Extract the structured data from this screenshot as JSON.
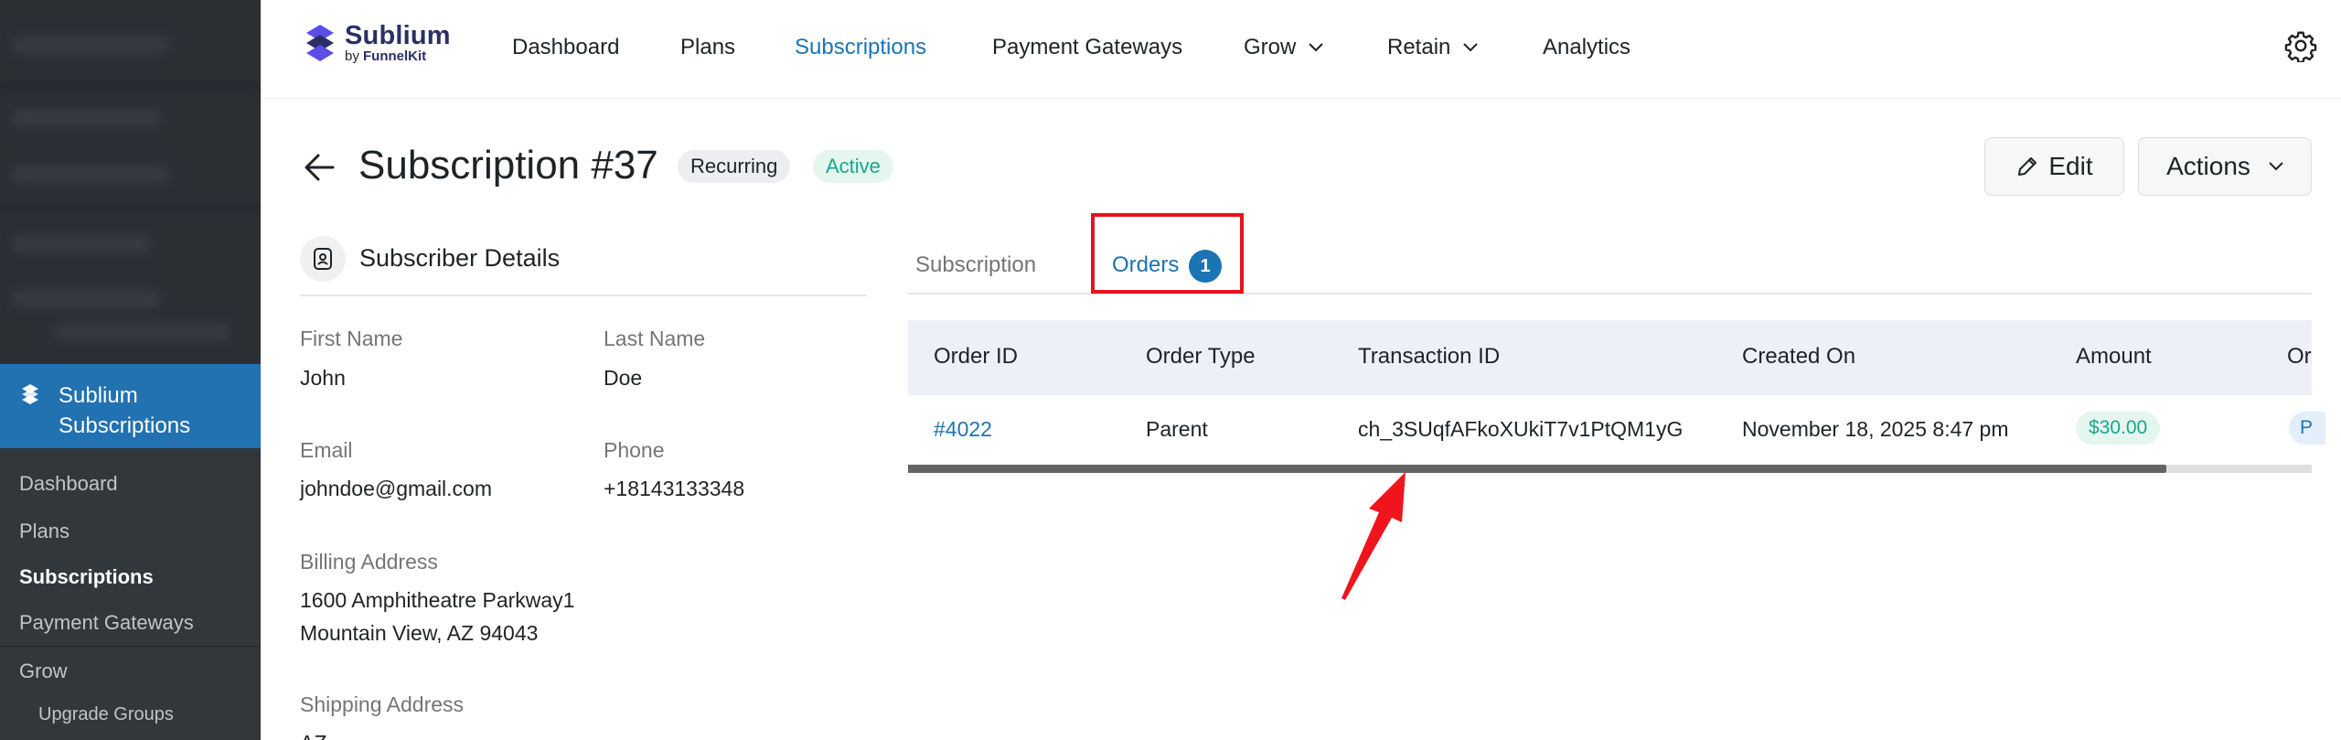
{
  "sidebar": {
    "active_menu": {
      "label_line1": "Sublium",
      "label_line2": "Subscriptions"
    },
    "sub_items": [
      {
        "label": "Dashboard"
      },
      {
        "label": "Plans"
      },
      {
        "label": "Subscriptions"
      },
      {
        "label": "Payment Gateways"
      },
      {
        "label": "Grow"
      },
      {
        "label": "Upgrade Groups"
      }
    ]
  },
  "brand": {
    "name": "Sublium",
    "by_prefix": "by ",
    "by_name": "FunnelKit"
  },
  "topnav": {
    "items": [
      {
        "label": "Dashboard"
      },
      {
        "label": "Plans"
      },
      {
        "label": "Subscriptions"
      },
      {
        "label": "Payment Gateways"
      },
      {
        "label": "Grow"
      },
      {
        "label": "Retain"
      },
      {
        "label": "Analytics"
      }
    ],
    "active": "Subscriptions"
  },
  "header": {
    "title": "Subscription #37",
    "badge_type": "Recurring",
    "badge_status": "Active",
    "edit_label": "Edit",
    "actions_label": "Actions"
  },
  "subscriber": {
    "section_title": "Subscriber Details",
    "first_name_label": "First Name",
    "first_name": "John",
    "last_name_label": "Last Name",
    "last_name": "Doe",
    "email_label": "Email",
    "email": "johndoe@gmail.com",
    "phone_label": "Phone",
    "phone": "+18143133348",
    "billing_label": "Billing Address",
    "billing_line1": "1600 Amphitheatre Parkway1",
    "billing_line2": "Mountain View, AZ 94043",
    "shipping_label": "Shipping Address",
    "shipping_partial": "AZ"
  },
  "tabs": [
    {
      "label": "Subscription"
    },
    {
      "label": "Orders",
      "count": "1"
    }
  ],
  "orders_table": {
    "columns": [
      "Order ID",
      "Order Type",
      "Transaction ID",
      "Created On",
      "Amount",
      "Or"
    ],
    "rows": [
      {
        "order_id": "#4022",
        "order_type": "Parent",
        "transaction_id": "ch_3SUqfAFkoXUkiT7v1PtQM1yG",
        "created_on": "November 18, 2025 8:47 pm",
        "amount": "$30.00",
        "status_partial": "P"
      }
    ]
  },
  "colors": {
    "accent": "#1b74b3",
    "wp_active": "#2271b1",
    "highlight": "#e8131c",
    "success": "#1aa68a"
  }
}
